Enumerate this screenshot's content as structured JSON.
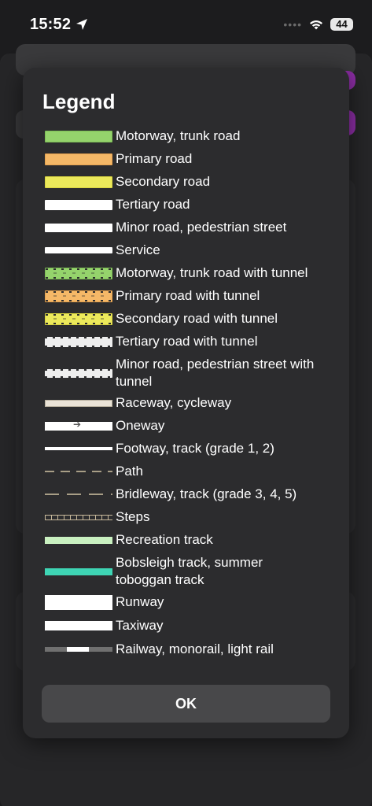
{
  "status_bar": {
    "time": "15:52",
    "signal_dots": "••••",
    "battery": "44",
    "icons": [
      "location-arrow-icon",
      "wifi-icon",
      "battery-icon"
    ]
  },
  "dialog": {
    "title": "Legend",
    "ok_label": "OK",
    "items": [
      {
        "label": "Motorway, trunk road",
        "style": "motorway",
        "color": "#95d36c"
      },
      {
        "label": "Primary road",
        "style": "primary",
        "color": "#f5b867"
      },
      {
        "label": "Secondary road",
        "style": "secondary",
        "color": "#ece95b"
      },
      {
        "label": "Tertiary road",
        "style": "tertiary",
        "color": "#ffffff"
      },
      {
        "label": "Minor road, pedestrian street",
        "style": "minor",
        "color": "#ffffff"
      },
      {
        "label": "Service",
        "style": "service",
        "color": "#ffffff"
      },
      {
        "label": "Motorway, trunk road with tunnel",
        "style": "motorway-tunnel",
        "color": "#95d36c"
      },
      {
        "label": "Primary road with tunnel",
        "style": "primary-tunnel",
        "color": "#f5b867"
      },
      {
        "label": "Secondary road with tunnel",
        "style": "secondary-tunnel",
        "color": "#ece95b"
      },
      {
        "label": "Tertiary road with tunnel",
        "style": "tertiary-tunnel",
        "color": "#ffffff"
      },
      {
        "label": "Minor road, pedestrian street with tunnel",
        "style": "minor-tunnel",
        "color": "#ffffff"
      },
      {
        "label": "Raceway, cycleway",
        "style": "raceway",
        "color": "#e9e2d6"
      },
      {
        "label": "Oneway",
        "style": "oneway",
        "color": "#ffffff"
      },
      {
        "label": "Footway, track (grade 1, 2)",
        "style": "footway",
        "color": "#ffffff"
      },
      {
        "label": "Path",
        "style": "path",
        "color": "#a89e86"
      },
      {
        "label": "Bridleway, track (grade 3, 4, 5)",
        "style": "bridleway",
        "color": "#a89e86"
      },
      {
        "label": "Steps",
        "style": "steps",
        "color": "#c8b99c"
      },
      {
        "label": "Recreation track",
        "style": "recreation",
        "color": "#c9f0c0"
      },
      {
        "label": "Bobsleigh track, summer toboggan track",
        "style": "bobsleigh",
        "color": "#3ed5b4"
      },
      {
        "label": "Runway",
        "style": "runway",
        "color": "#ffffff"
      },
      {
        "label": "Taxiway",
        "style": "taxiway",
        "color": "#ffffff"
      },
      {
        "label": "Railway, monorail, light rail",
        "style": "railway",
        "color": "#707070"
      }
    ]
  }
}
